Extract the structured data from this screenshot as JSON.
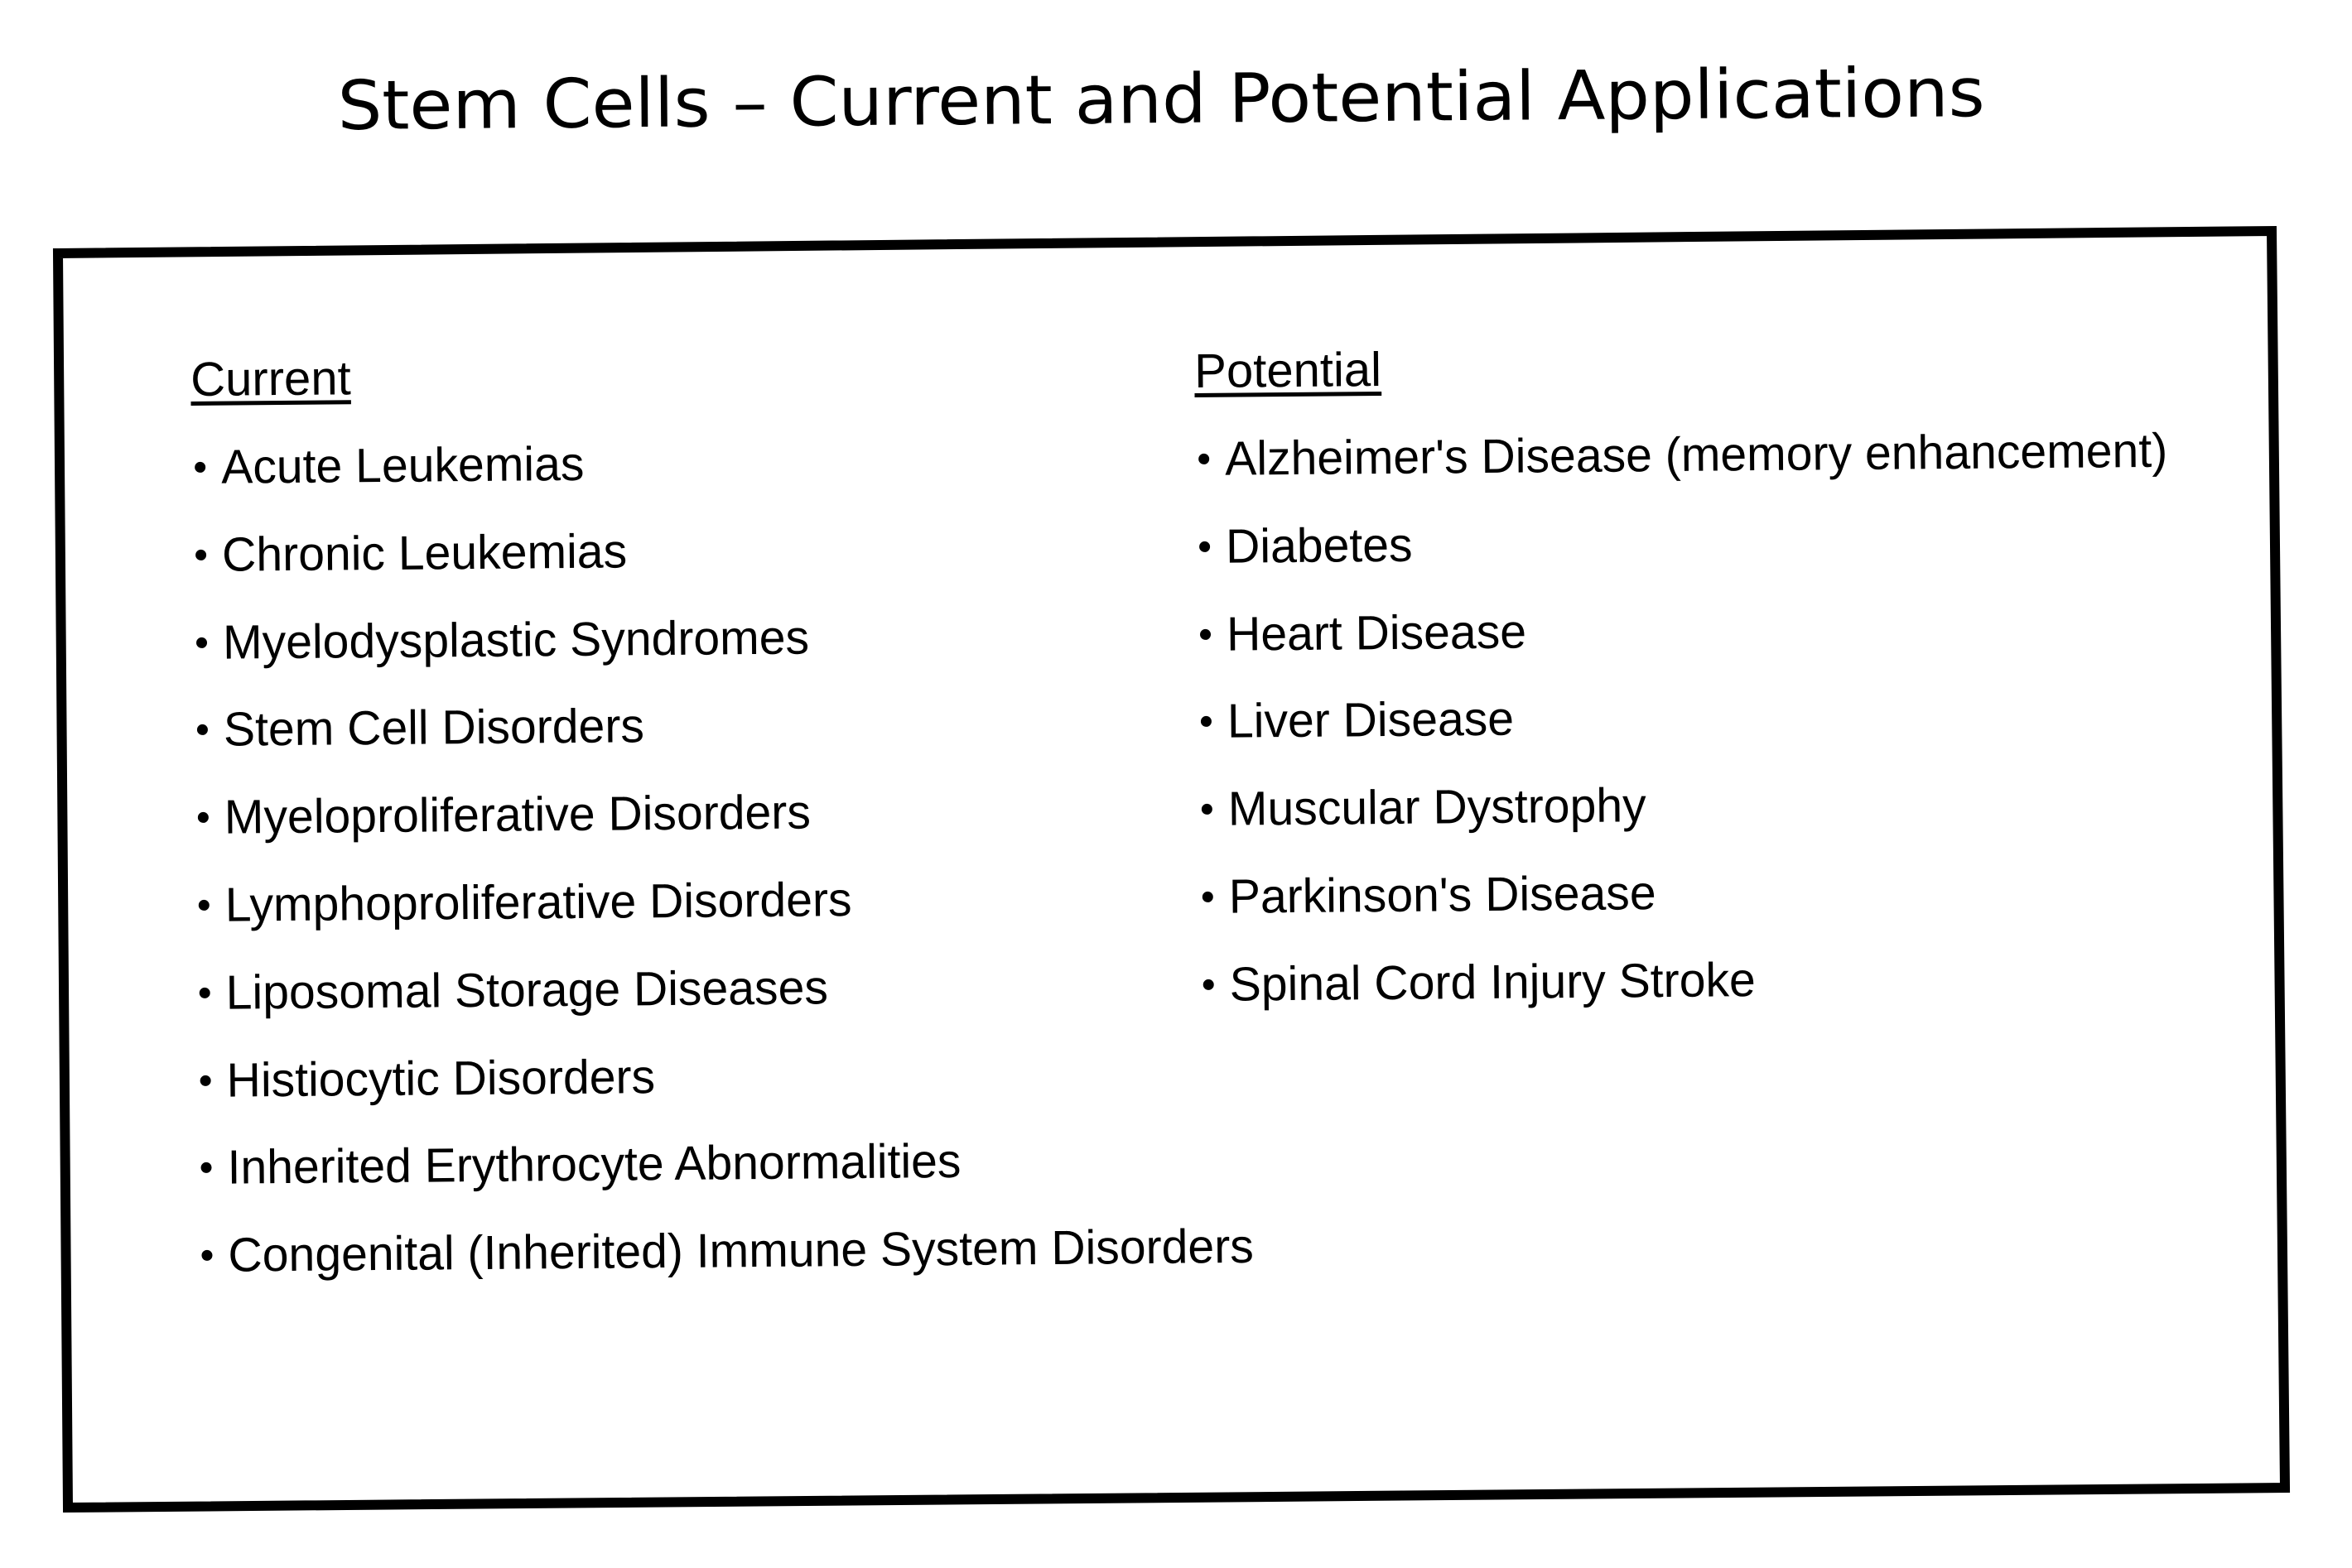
{
  "title": "Stem Cells – Current and Potential Applications",
  "current": {
    "heading": "Current",
    "items": [
      "Acute Leukemias",
      "Chronic Leukemias",
      "Myelodysplastic Syndromes",
      "Stem Cell Disorders",
      "Myeloproliferative Disorders",
      "Lymphoproliferative Disorders",
      "Liposomal Storage Diseases",
      "Histiocytic Disorders",
      "Inherited Erythrocyte Abnormalities",
      "Congenital (Inherited) Immune System Disorders"
    ]
  },
  "potential": {
    "heading": "Potential",
    "items": [
      "Alzheimer's Disease (memory enhancement)",
      "Diabetes",
      "Heart Disease",
      "Liver Disease",
      "Muscular Dystrophy",
      "Parkinson's Disease",
      "Spinal Cord Injury Stroke"
    ]
  },
  "colors": {
    "ink": "#000000",
    "paper": "#ffffff"
  }
}
